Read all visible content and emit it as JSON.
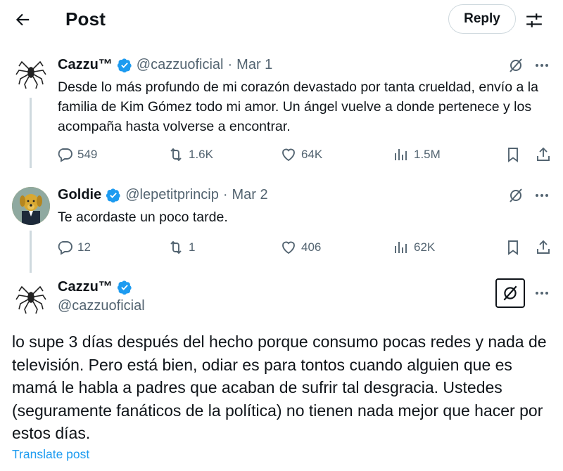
{
  "header": {
    "title": "Post",
    "reply_label": "Reply",
    "back_icon": "arrow-left-icon",
    "settings_icon": "sliders-icon"
  },
  "colors": {
    "text": "#0f1419",
    "secondary": "#536471",
    "verified": "#1d9bf0",
    "link": "#1d9bf0",
    "line": "#cfd9de"
  },
  "tweets": [
    {
      "name": "Cazzu™",
      "handle": "@cazzuoficial",
      "separator": "·",
      "date": "Mar 1",
      "text": "Desde lo más profundo de mi corazón devastado por tanta crueldad, envío a la familia de Kim Gómez todo mi amor. Un ángel vuelve a donde pertenece y los acompaña hasta volverse a encontrar.",
      "replies": "549",
      "reposts": "1.6K",
      "likes": "64K",
      "views": "1.5M"
    },
    {
      "name": "Goldie",
      "handle": "@lepetitprincip",
      "separator": "·",
      "date": "Mar 2",
      "text": "Te acordaste un poco tarde.",
      "replies": "12",
      "reposts": "1",
      "likes": "406",
      "views": "62K"
    }
  ],
  "main_tweet": {
    "name": "Cazzu™",
    "handle": "@cazzuoficial",
    "text": "lo supe 3 días después del hecho porque consumo pocas redes y nada de televisión. Pero está bien, odiar es para tontos cuando alguien que es mamá le habla a padres que acaban de sufrir tal desgracia. Ustedes (seguramente fanáticos de la política) no tienen nada mejor que hacer por estos días.",
    "translate_label": "Translate post"
  }
}
